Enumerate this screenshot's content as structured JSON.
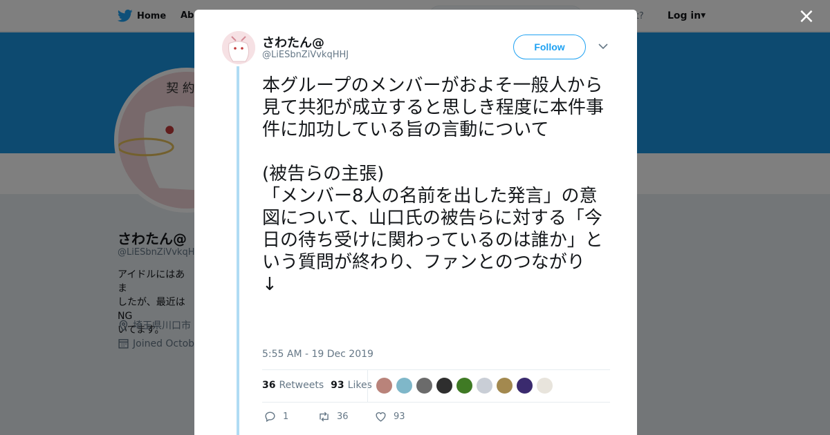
{
  "background": {
    "nav": {
      "home_label": "Home",
      "about_label": "Abo",
      "account_text": "ccount?",
      "login_label": "Log in"
    },
    "profile": {
      "name": "さわたん@",
      "handle": "@LiESbnZiVvkqHH",
      "bio": "アイドルにはあま\nしたが、最近はNG\nいてます。",
      "location": "埼玉県川口市",
      "joined": "Joined October"
    }
  },
  "modal": {
    "close_label": "×",
    "author": {
      "name": "さわたん@",
      "handle": "@LiESbnZiVvkqHHJ"
    },
    "follow_label": "Follow",
    "tweet_text": "本グループのメンバーがおよそ一般人から見て共犯が成立すると思しき程度に本件事件に加功している旨の言動について\n\n(被告らの主張)\n「メンバー8人の名前を出した発言」の意図について、山口氏の被告らに対する「今日の待ち受けに関わっているのは誰か」という質問が終わり、ファンとのつながり\n↓",
    "timestamp": "5:55 AM - 19 Dec 2019",
    "stats": {
      "retweets_count": "36",
      "retweets_label": "Retweets",
      "likes_count": "93",
      "likes_label": "Likes"
    },
    "likers": [
      {
        "name": "liker-avatar-1",
        "color": "#b9837a"
      },
      {
        "name": "liker-avatar-2",
        "color": "#7fb7c9"
      },
      {
        "name": "liker-avatar-3",
        "color": "#6b6b6b"
      },
      {
        "name": "liker-avatar-4",
        "color": "#2e2e2e"
      },
      {
        "name": "liker-avatar-5",
        "color": "#3f7a24"
      },
      {
        "name": "liker-avatar-6",
        "color": "#c9ced6"
      },
      {
        "name": "liker-avatar-7",
        "color": "#a3894f"
      },
      {
        "name": "liker-avatar-8",
        "color": "#3a2a6e"
      },
      {
        "name": "liker-avatar-9",
        "color": "#e8e4dc"
      }
    ],
    "actions": {
      "replies": "1",
      "retweets": "36",
      "likes": "93"
    }
  },
  "colors": {
    "accent": "#1da1f2",
    "banner": "#1b95e0",
    "thread_line": "#b0dcf4"
  }
}
